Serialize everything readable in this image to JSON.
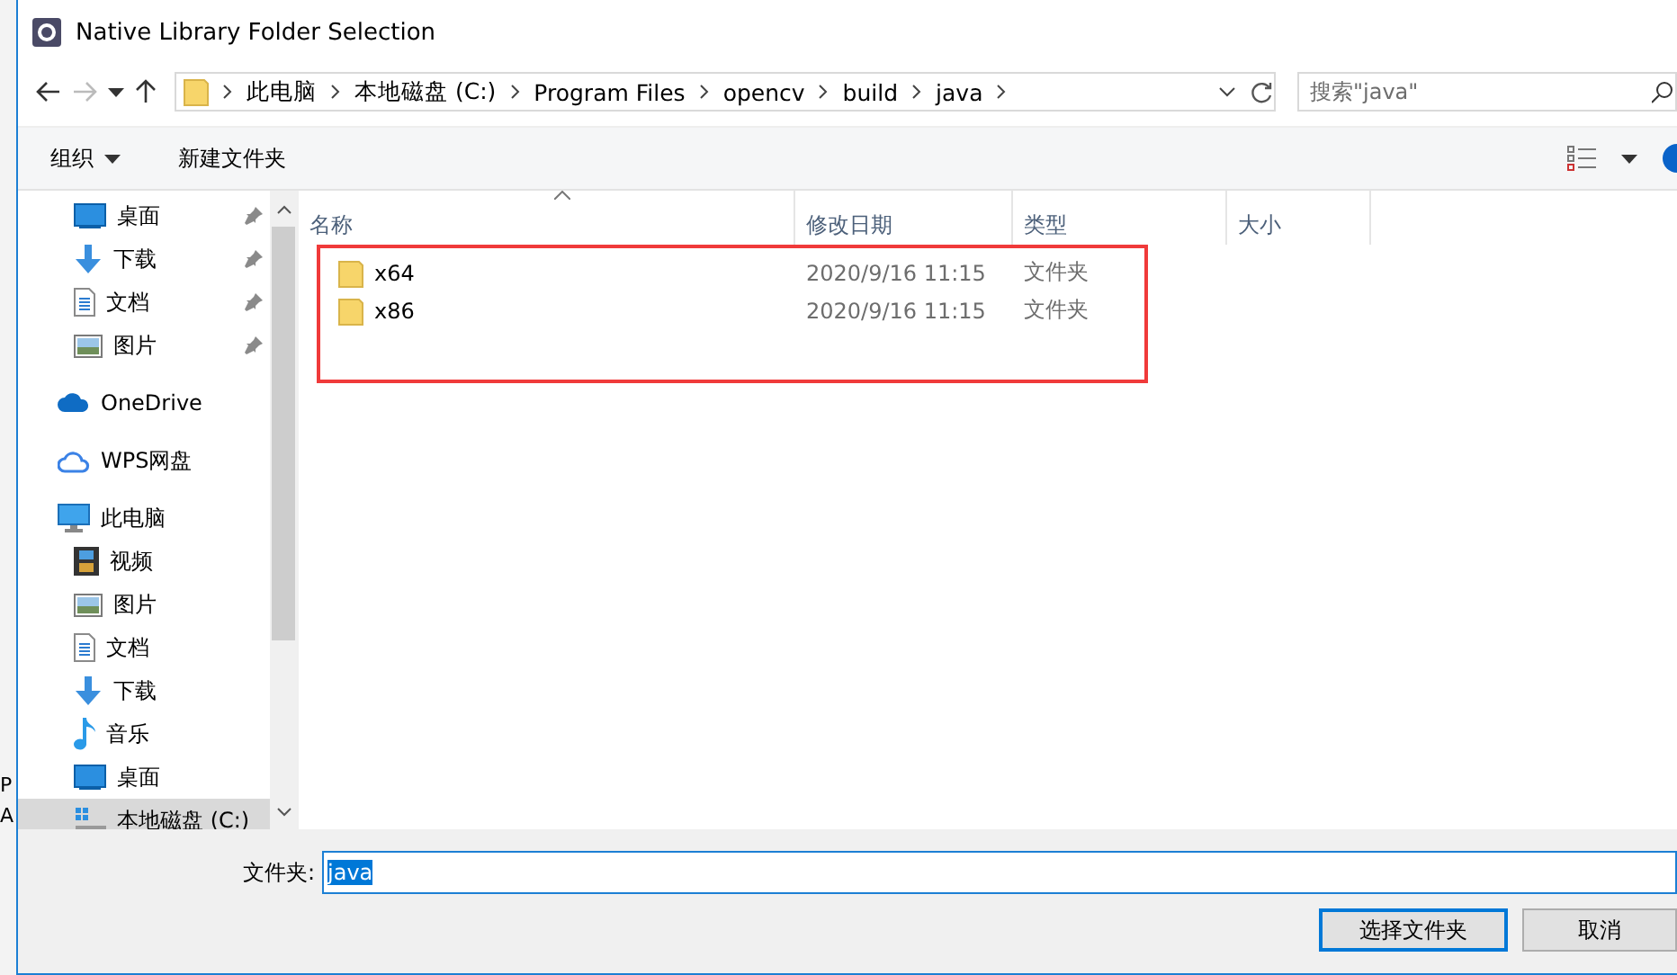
{
  "window": {
    "title": "Native Library Folder Selection"
  },
  "background_fragments": [
    "P",
    "A"
  ],
  "nav": {
    "back_disabled": false,
    "forward_disabled": true
  },
  "breadcrumb": [
    "此电脑",
    "本地磁盘 (C:)",
    "Program Files",
    "opencv",
    "build",
    "java"
  ],
  "search": {
    "placeholder": "搜索\"java\""
  },
  "toolbar": {
    "organize": "组织",
    "new_folder": "新建文件夹"
  },
  "sidebar": {
    "quick_access_children": [
      {
        "label": "桌面",
        "kind": "desktop",
        "pinned": true,
        "selected": false
      },
      {
        "label": "下载",
        "kind": "download",
        "pinned": true,
        "selected": false
      },
      {
        "label": "文档",
        "kind": "document",
        "pinned": true,
        "selected": false
      },
      {
        "label": "图片",
        "kind": "picture",
        "pinned": true,
        "selected": false
      }
    ],
    "items": [
      {
        "label": "OneDrive",
        "kind": "onedrive",
        "selected": false
      },
      {
        "label": "WPS网盘",
        "kind": "cloud",
        "selected": false
      },
      {
        "label": "此电脑",
        "kind": "computer",
        "selected": false,
        "children": [
          {
            "label": "视频",
            "kind": "video",
            "selected": false
          },
          {
            "label": "图片",
            "kind": "picture",
            "selected": false
          },
          {
            "label": "文档",
            "kind": "document",
            "selected": false
          },
          {
            "label": "下载",
            "kind": "download",
            "selected": false
          },
          {
            "label": "音乐",
            "kind": "music",
            "selected": false
          },
          {
            "label": "桌面",
            "kind": "desktop",
            "selected": false
          },
          {
            "label": "本地磁盘 (C:)",
            "kind": "drive",
            "selected": true
          }
        ]
      }
    ]
  },
  "file_list": {
    "columns": [
      "名称",
      "修改日期",
      "类型",
      "大小"
    ],
    "rows": [
      {
        "name": "x64",
        "modified": "2020/9/16 11:15",
        "type": "文件夹"
      },
      {
        "name": "x86",
        "modified": "2020/9/16 11:15",
        "type": "文件夹"
      }
    ]
  },
  "footer": {
    "folder_label": "文件夹:",
    "folder_value": "java",
    "buttons": [
      {
        "label": "选择文件夹",
        "default": true
      },
      {
        "label": "取消",
        "default": false
      }
    ]
  }
}
